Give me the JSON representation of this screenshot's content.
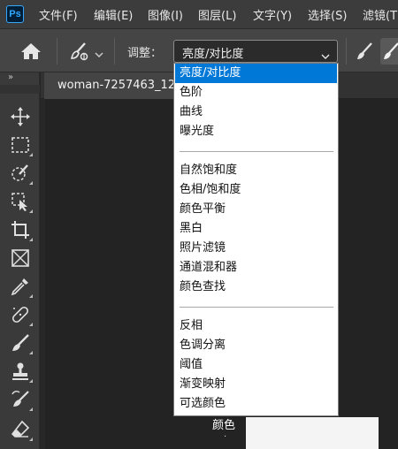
{
  "app": {
    "logo": "Ps",
    "colors": {
      "accent": "#31a8ff",
      "selection": "#0078d7",
      "panel": "#3a3a3a"
    }
  },
  "menubar": {
    "items": [
      "文件(F)",
      "编辑(E)",
      "图像(I)",
      "图层(L)",
      "文字(Y)",
      "选择(S)",
      "滤镜(T"
    ]
  },
  "options_bar": {
    "home_icon": "home-icon",
    "tool_icon": "brush-adjust-icon",
    "adjust_label": "调整：",
    "adjust_value": "亮度/对比度"
  },
  "toolbar": {
    "grip": "»",
    "tools": [
      "move-icon",
      "marquee-icon",
      "quick-select-icon",
      "object-select-icon",
      "crop-icon",
      "frame-icon",
      "eyedropper-icon",
      "healing-icon",
      "brush-icon",
      "stamp-icon",
      "history-brush-icon",
      "eraser-icon"
    ]
  },
  "document": {
    "tab_label": "woman-7257463_12",
    "canvas_text": "颜色",
    "canvas_text2": "."
  },
  "dropdown": {
    "groups": [
      [
        "亮度/对比度",
        "色阶",
        "曲线",
        "曝光度"
      ],
      [
        "自然饱和度",
        "色相/饱和度",
        "颜色平衡",
        "黑白",
        "照片滤镜",
        "通道混和器",
        "颜色查找"
      ],
      [
        "反相",
        "色调分离",
        "阈值",
        "渐变映射",
        "可选颜色"
      ]
    ],
    "selected": "亮度/对比度"
  }
}
